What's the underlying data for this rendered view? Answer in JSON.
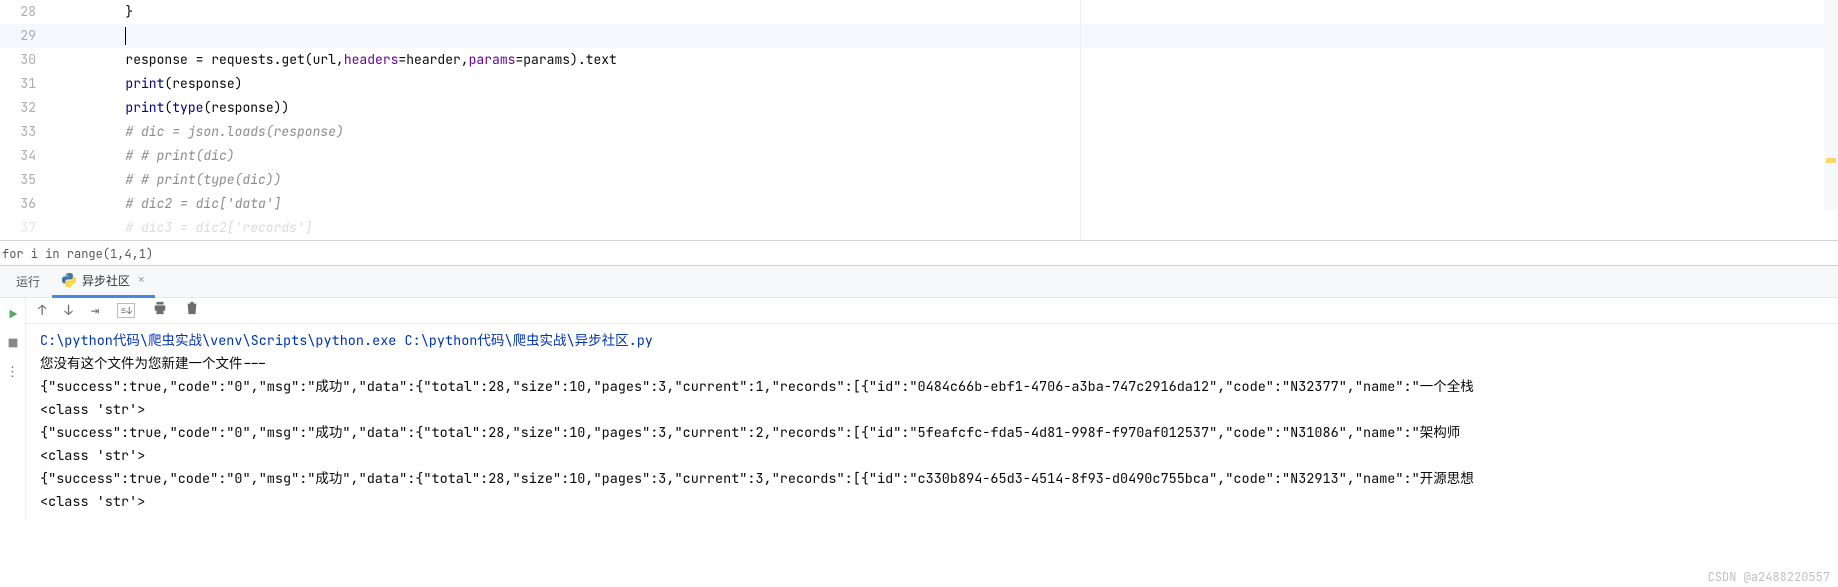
{
  "editor": {
    "lines": [
      {
        "num": "28",
        "highlight": false,
        "tokens": [
          {
            "t": "        ",
            "c": ""
          },
          {
            "t": "}",
            "c": ""
          }
        ]
      },
      {
        "num": "29",
        "highlight": true,
        "tokens": [
          {
            "t": "        ",
            "c": ""
          }
        ],
        "cursor": true
      },
      {
        "num": "30",
        "highlight": false,
        "tokens": [
          {
            "t": "        response = requests.get(url,",
            "c": ""
          },
          {
            "t": "headers",
            "c": "k-param"
          },
          {
            "t": "=hearder,",
            "c": ""
          },
          {
            "t": "params",
            "c": "k-param"
          },
          {
            "t": "=params).text",
            "c": ""
          }
        ]
      },
      {
        "num": "31",
        "highlight": false,
        "tokens": [
          {
            "t": "        ",
            "c": ""
          },
          {
            "t": "print",
            "c": "k-builtin"
          },
          {
            "t": "(response)",
            "c": ""
          }
        ]
      },
      {
        "num": "32",
        "highlight": false,
        "tokens": [
          {
            "t": "        ",
            "c": ""
          },
          {
            "t": "print",
            "c": "k-builtin"
          },
          {
            "t": "(",
            "c": ""
          },
          {
            "t": "type",
            "c": "k-builtin"
          },
          {
            "t": "(response))",
            "c": ""
          }
        ]
      },
      {
        "num": "33",
        "highlight": false,
        "tokens": [
          {
            "t": "        ",
            "c": ""
          },
          {
            "t": "# dic = json.loads(response)",
            "c": "k-comment"
          }
        ]
      },
      {
        "num": "34",
        "highlight": false,
        "tokens": [
          {
            "t": "        ",
            "c": ""
          },
          {
            "t": "# # print(dic)",
            "c": "k-comment"
          }
        ]
      },
      {
        "num": "35",
        "highlight": false,
        "tokens": [
          {
            "t": "        ",
            "c": ""
          },
          {
            "t": "# # print(type(dic))",
            "c": "k-comment"
          }
        ]
      },
      {
        "num": "36",
        "highlight": false,
        "tokens": [
          {
            "t": "        ",
            "c": ""
          },
          {
            "t": "# dic2 = dic['data']",
            "c": "k-comment"
          }
        ]
      },
      {
        "num": "37",
        "highlight": false,
        "tokens": [
          {
            "t": "        ",
            "c": ""
          },
          {
            "t": "# dic3 = dic2['records']",
            "c": "k-comment"
          }
        ],
        "faded": true
      }
    ]
  },
  "breadcrumb": "for i in range(1,4,1)",
  "run": {
    "label": "运行",
    "tab_name": "异步社区"
  },
  "console": {
    "cmd": "C:\\python代码\\爬虫实战\\venv\\Scripts\\python.exe C:\\python代码\\爬虫实战\\异步社区.py",
    "lines": [
      "您没有这个文件为您新建一个文件---",
      "{\"success\":true,\"code\":\"0\",\"msg\":\"成功\",\"data\":{\"total\":28,\"size\":10,\"pages\":3,\"current\":1,\"records\":[{\"id\":\"0484c66b-ebf1-4706-a3ba-747c2916da12\",\"code\":\"N32377\",\"name\":\"一个全栈",
      "<class 'str'>",
      "{\"success\":true,\"code\":\"0\",\"msg\":\"成功\",\"data\":{\"total\":28,\"size\":10,\"pages\":3,\"current\":2,\"records\":[{\"id\":\"5feafcfc-fda5-4d81-998f-f970af012537\",\"code\":\"N31086\",\"name\":\"架构师",
      "<class 'str'>",
      "{\"success\":true,\"code\":\"0\",\"msg\":\"成功\",\"data\":{\"total\":28,\"size\":10,\"pages\":3,\"current\":3,\"records\":[{\"id\":\"c330b894-65d3-4514-8f93-d0490c755bca\",\"code\":\"N32913\",\"name\":\"开源思想",
      "<class 'str'>"
    ]
  },
  "watermark": "CSDN @a2488220557"
}
